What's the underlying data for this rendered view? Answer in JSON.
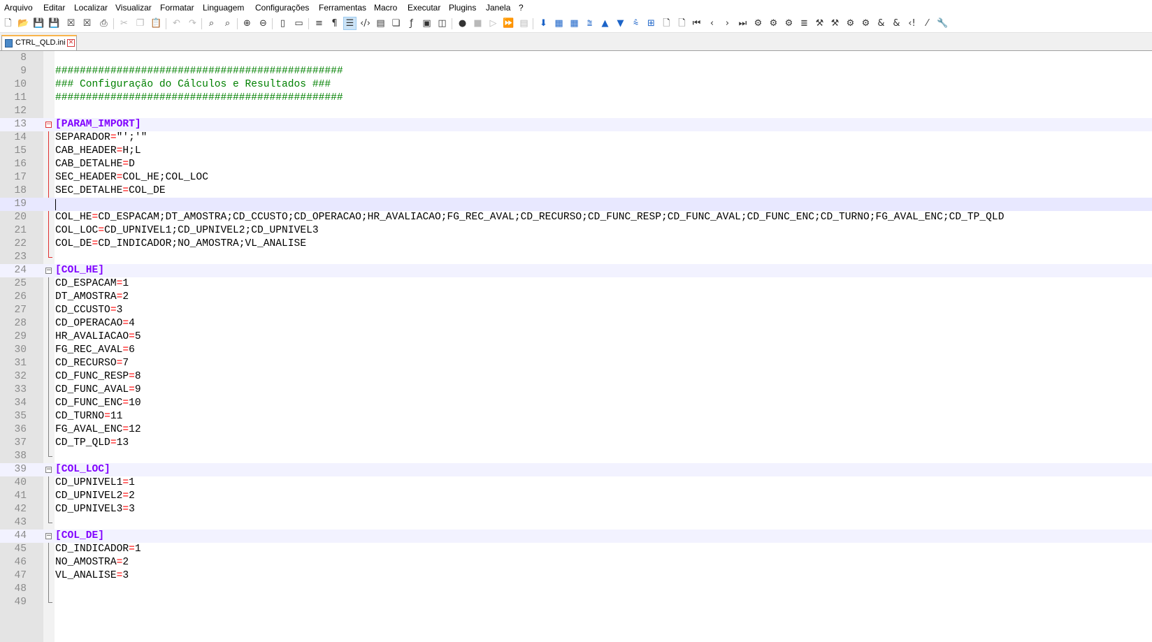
{
  "menu": {
    "items": [
      "Arquivo",
      "Editar",
      "Localizar",
      "Visualizar",
      "Formatar",
      "Linguagem",
      "Configurações",
      "Ferramentas",
      "Macro",
      "Executar",
      "Plugins",
      "Janela",
      "?"
    ]
  },
  "toolbar": {
    "icons": [
      "new-file",
      "open-file",
      "save",
      "save-all",
      "close",
      "close-all",
      "print",
      "cut",
      "copy",
      "paste",
      "undo",
      "redo",
      "find",
      "replace",
      "zoom-in",
      "zoom-out",
      "sync-vertical",
      "sync-horizontal",
      "word-wrap",
      "show-all-characters",
      "indent-guide",
      "xml-tags",
      "document-map",
      "function-list",
      "fx",
      "monitoring",
      "folder-workspace",
      "record-macro",
      "stop-recording",
      "play-macro",
      "run-macro-multiple",
      "save-macro"
    ]
  },
  "tabs": [
    {
      "label": "CTRL_QLD.ini",
      "active": true
    }
  ],
  "editor": {
    "lines": [
      {
        "n": "8",
        "text": "",
        "type": "plain"
      },
      {
        "n": "9",
        "text": "###############################################",
        "type": "comment"
      },
      {
        "n": "10",
        "text": "### Configuração do Cálculos e Resultados ###",
        "type": "comment"
      },
      {
        "n": "11",
        "text": "###############################################",
        "type": "comment"
      },
      {
        "n": "12",
        "text": "",
        "type": "plain"
      },
      {
        "n": "13",
        "text": "[PARAM_IMPORT]",
        "type": "section"
      },
      {
        "n": "14",
        "text": "SEPARADOR=\"';'\"",
        "type": "kv"
      },
      {
        "n": "15",
        "text": "CAB_HEADER=H;L",
        "type": "kv"
      },
      {
        "n": "16",
        "text": "CAB_DETALHE=D",
        "type": "kv"
      },
      {
        "n": "17",
        "text": "SEC_HEADER=COL_HE;COL_LOC",
        "type": "kv"
      },
      {
        "n": "18",
        "text": "SEC_DETALHE=COL_DE",
        "type": "kv"
      },
      {
        "n": "19",
        "text": "",
        "type": "plain"
      },
      {
        "n": "20",
        "text": "COL_HE=CD_ESPACAM;DT_AMOSTRA;CD_CCUSTO;CD_OPERACAO;HR_AVALIACAO;FG_REC_AVAL;CD_RECURSO;CD_FUNC_RESP;CD_FUNC_AVAL;CD_FUNC_ENC;CD_TURNO;FG_AVAL_ENC;CD_TP_QLD",
        "type": "kv"
      },
      {
        "n": "21",
        "text": "COL_LOC=CD_UPNIVEL1;CD_UPNIVEL2;CD_UPNIVEL3",
        "type": "kv"
      },
      {
        "n": "22",
        "text": "COL_DE=CD_INDICADOR;NO_AMOSTRA;VL_ANALISE",
        "type": "kv"
      },
      {
        "n": "23",
        "text": "",
        "type": "plain"
      },
      {
        "n": "24",
        "text": "[COL_HE]",
        "type": "section"
      },
      {
        "n": "25",
        "text": "CD_ESPACAM=1",
        "type": "kv"
      },
      {
        "n": "26",
        "text": "DT_AMOSTRA=2",
        "type": "kv"
      },
      {
        "n": "27",
        "text": "CD_CCUSTO=3",
        "type": "kv"
      },
      {
        "n": "28",
        "text": "CD_OPERACAO=4",
        "type": "kv"
      },
      {
        "n": "29",
        "text": "HR_AVALIACAO=5",
        "type": "kv"
      },
      {
        "n": "30",
        "text": "FG_REC_AVAL=6",
        "type": "kv"
      },
      {
        "n": "31",
        "text": "CD_RECURSO=7",
        "type": "kv"
      },
      {
        "n": "32",
        "text": "CD_FUNC_RESP=8",
        "type": "kv"
      },
      {
        "n": "33",
        "text": "CD_FUNC_AVAL=9",
        "type": "kv"
      },
      {
        "n": "34",
        "text": "CD_FUNC_ENC=10",
        "type": "kv"
      },
      {
        "n": "35",
        "text": "CD_TURNO=11",
        "type": "kv"
      },
      {
        "n": "36",
        "text": "FG_AVAL_ENC=12",
        "type": "kv"
      },
      {
        "n": "37",
        "text": "CD_TP_QLD=13",
        "type": "kv"
      },
      {
        "n": "38",
        "text": "",
        "type": "plain"
      },
      {
        "n": "39",
        "text": "[COL_LOC]",
        "type": "section"
      },
      {
        "n": "40",
        "text": "CD_UPNIVEL1=1",
        "type": "kv"
      },
      {
        "n": "41",
        "text": "CD_UPNIVEL2=2",
        "type": "kv"
      },
      {
        "n": "42",
        "text": "CD_UPNIVEL3=3",
        "type": "kv"
      },
      {
        "n": "43",
        "text": "",
        "type": "plain"
      },
      {
        "n": "44",
        "text": "[COL_DE]",
        "type": "section"
      },
      {
        "n": "45",
        "text": "CD_INDICADOR=1",
        "type": "kv"
      },
      {
        "n": "46",
        "text": "NO_AMOSTRA=2",
        "type": "kv"
      },
      {
        "n": "47",
        "text": "VL_ANALISE=3",
        "type": "kv"
      },
      {
        "n": "48",
        "text": "",
        "type": "plain"
      },
      {
        "n": "49",
        "text": "",
        "type": "plain"
      }
    ]
  },
  "colors": {
    "section": "#8000ff",
    "comment": "#008000",
    "operator": "#ff0000",
    "current_line": "#e8e8ff",
    "tab_accent": "#f9b44b"
  }
}
